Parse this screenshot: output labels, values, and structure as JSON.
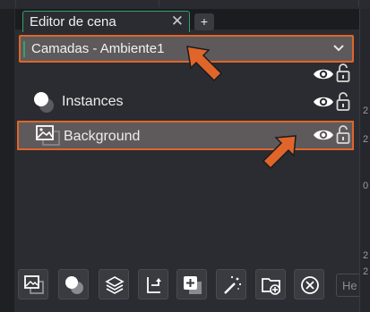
{
  "editor": {
    "tab_label": "Editor de cena",
    "close_symbol": "✕",
    "add_tab_symbol": "+"
  },
  "layers_dropdown": {
    "selected": "Camadas - Ambiente1"
  },
  "layers": [
    {
      "label": "Instances",
      "icon": "instances-icon",
      "visible": true,
      "locked": false,
      "selected": false
    },
    {
      "label": "Background",
      "icon": "image-icon",
      "visible": true,
      "locked": false,
      "selected": true
    }
  ],
  "toolbar": {
    "buttons": [
      "add-background-layer-icon",
      "add-instances-layer-icon",
      "add-layers-icon",
      "layer-flow-icon",
      "duplicate-layer-icon",
      "magic-wand-icon",
      "add-folder-icon",
      "delete-icon"
    ],
    "search_hint": "He"
  },
  "right_edge_labels": [
    "2",
    "2",
    "0",
    "2",
    "2"
  ],
  "colors": {
    "accent_orange": "#e0652a",
    "accent_green": "#2fa36b",
    "selected_bg": "#5e5a5b"
  }
}
